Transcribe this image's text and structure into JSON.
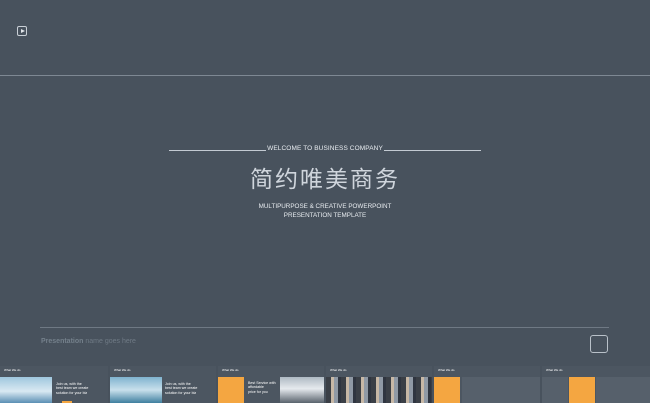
{
  "header": {
    "welcome": "WELCOME TO BUSINESS COMPANY",
    "title_cn": "简约唯美商务",
    "subtitle_line1": "MULTIPURPOSE & CREATIVE POWERPOINT",
    "subtitle_line2": "PRESENTATION TEMPLATE"
  },
  "footer": {
    "presentation_label": "Presentation",
    "presentation_hint": "name goes here"
  },
  "thumbnails": {
    "t1": {
      "caption": "What We do",
      "text1": "Join us, with the",
      "text2": "best team we create",
      "text3": "solution for your biz"
    },
    "t2": {
      "caption": "What We do",
      "text1": "Join us, with the",
      "text2": "best team we create",
      "text3": "solution for your biz"
    },
    "t3": {
      "caption": "What We do",
      "text1": "Best Service with",
      "text2": "affordable",
      "text3": "price for you"
    },
    "t4": {
      "caption": "What We do"
    },
    "t5": {
      "caption": "What We do"
    },
    "t6": {
      "caption": "What We do"
    }
  },
  "colors": {
    "background": "#48525d",
    "accent_orange": "#f4a641",
    "text_light": "#e9edf1"
  }
}
